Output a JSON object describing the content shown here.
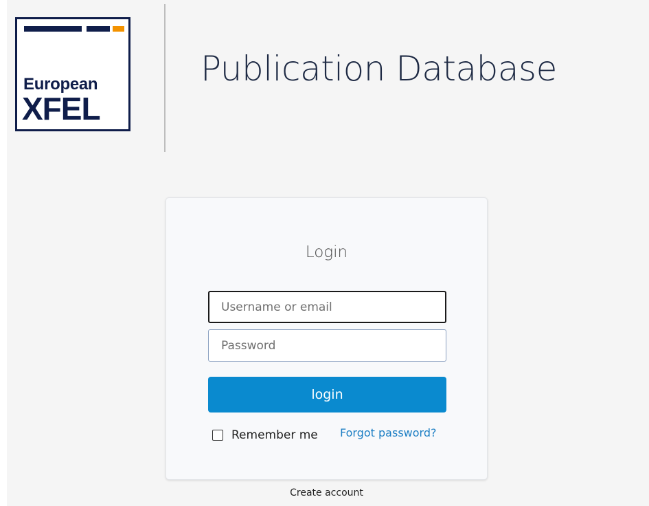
{
  "logo": {
    "line1": "European",
    "line2": "XFEL",
    "bar_color_primary": "#0f1d4a",
    "bar_color_accent": "#f39200"
  },
  "header": {
    "title": "Publication Database"
  },
  "login": {
    "heading": "Login",
    "username_placeholder": "Username or email",
    "username_value": "",
    "password_placeholder": "Password",
    "password_value": "",
    "submit_label": "login",
    "remember_label": "Remember me",
    "remember_checked": false,
    "forgot_label": "Forgot password?"
  },
  "footer": {
    "create_account_label": "Create account"
  },
  "colors": {
    "button": "#0a8acf",
    "link": "#1d7fc4",
    "title": "#1e2a44"
  }
}
